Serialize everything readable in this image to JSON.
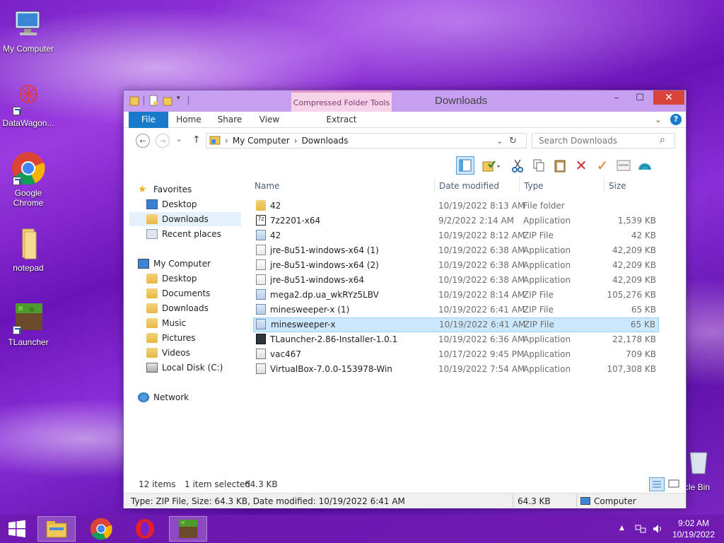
{
  "desktop": {
    "icons": [
      {
        "label": "My Computer"
      },
      {
        "label": "DataWagon..."
      },
      {
        "label": "Google Chrome"
      },
      {
        "label": "notepad"
      },
      {
        "label": "TLauncher"
      },
      {
        "label": "cle Bin"
      }
    ]
  },
  "window": {
    "title": "Downloads",
    "context_tab_title": "Compressed Folder Tools",
    "ribbon_tabs": [
      "File",
      "Home",
      "Share",
      "View",
      "Extract"
    ],
    "controls": {
      "minimize": "–",
      "maximize": "☐",
      "close": "✕",
      "expand": "⌄",
      "help": "?"
    },
    "nav": {
      "back": "←",
      "forward": "→",
      "recent": "⌄",
      "up": "↑",
      "breadcrumb": [
        "My Computer",
        "Downloads"
      ],
      "separator": "›",
      "refresh": "↻",
      "search_placeholder": "Search Downloads",
      "search_icon": "⌕"
    },
    "navpane": {
      "favorites": "Favorites",
      "favorites_items": [
        "Desktop",
        "Downloads",
        "Recent places"
      ],
      "computer": "My Computer",
      "computer_items": [
        "Desktop",
        "Documents",
        "Downloads",
        "Music",
        "Pictures",
        "Videos",
        "Local Disk (C:)"
      ],
      "network": "Network"
    },
    "columns": {
      "name": "Name",
      "date": "Date modified",
      "type": "Type",
      "size": "Size"
    },
    "files": [
      {
        "name": "42",
        "date": "10/19/2022 8:13 AM",
        "type": "File folder",
        "size": ""
      },
      {
        "name": "7z2201-x64",
        "date": "9/2/2022 2:14 AM",
        "type": "Application",
        "size": "1,539 KB"
      },
      {
        "name": "42",
        "date": "10/19/2022 8:12 AM",
        "type": "ZIP File",
        "size": "42 KB"
      },
      {
        "name": "jre-8u51-windows-x64 (1)",
        "date": "10/19/2022 6:38 AM",
        "type": "Application",
        "size": "42,209 KB"
      },
      {
        "name": "jre-8u51-windows-x64 (2)",
        "date": "10/19/2022 6:38 AM",
        "type": "Application",
        "size": "42,209 KB"
      },
      {
        "name": "jre-8u51-windows-x64",
        "date": "10/19/2022 6:38 AM",
        "type": "Application",
        "size": "42,209 KB"
      },
      {
        "name": "mega2.dp.ua_wkRYz5LBV",
        "date": "10/19/2022 8:14 AM",
        "type": "ZIP File",
        "size": "105,276 KB"
      },
      {
        "name": "minesweeper-x (1)",
        "date": "10/19/2022 6:41 AM",
        "type": "ZIP File",
        "size": "65 KB"
      },
      {
        "name": "minesweeper-x",
        "date": "10/19/2022 6:41 AM",
        "type": "ZIP File",
        "size": "65 KB"
      },
      {
        "name": "TLauncher-2.86-Installer-1.0.1",
        "date": "10/19/2022 6:36 AM",
        "type": "Application",
        "size": "22,178 KB"
      },
      {
        "name": "vac467",
        "date": "10/17/2022 9:45 PM",
        "type": "Application",
        "size": "709 KB"
      },
      {
        "name": "VirtualBox-7.0.0-153978-Win",
        "date": "10/19/2022 7:54 AM",
        "type": "Application",
        "size": "107,308 KB"
      }
    ],
    "status": {
      "items": "12 items",
      "selected": "1 item selected",
      "selected_size": "64.3 KB"
    },
    "details": {
      "info": "Type: ZIP File, Size: 64.3 KB, Date modified: 10/19/2022 6:41 AM",
      "size": "64.3 KB",
      "location": "Computer"
    }
  },
  "taskbar": {
    "start_icon": "windows-logo",
    "time": "9:02 AM",
    "date": "10/19/2022",
    "tray_up": "▲"
  }
}
